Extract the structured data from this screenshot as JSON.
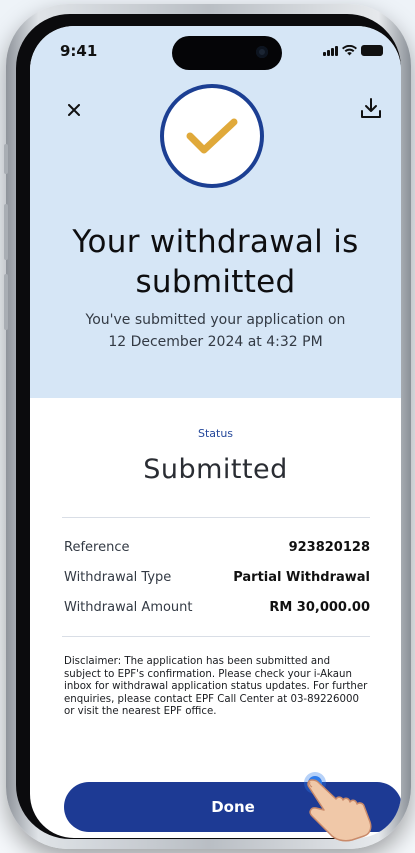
{
  "status_bar": {
    "time": "9:41"
  },
  "hero": {
    "close_icon": "close-icon",
    "download_icon": "download-icon",
    "check_icon": "checkmark-icon",
    "title_line1": "Your withdrawal is",
    "title_line2": "submitted",
    "subtitle_line1": "You've submitted your application on",
    "subtitle_line2": "12 December 2024 at 4:32 PM"
  },
  "status": {
    "label": "Status",
    "value": "Submitted"
  },
  "details": [
    {
      "label": "Reference",
      "value": "923820128"
    },
    {
      "label": "Withdrawal Type",
      "value": "Partial Withdrawal"
    },
    {
      "label": "Withdrawal Amount",
      "value": "RM 30,000.00"
    }
  ],
  "disclaimer": "Disclaimer: The application has been submitted and subject to EPF's confirmation. Please check your i-Akaun inbox for withdrawal application status updates. For further enquiries, please contact EPF Call Center at 03-89226000 or visit the nearest EPF office.",
  "actions": {
    "done_label": "Done"
  },
  "colors": {
    "hero_bg": "#d6e6f6",
    "primary": "#1d3a94",
    "check": "#e0a93a"
  }
}
